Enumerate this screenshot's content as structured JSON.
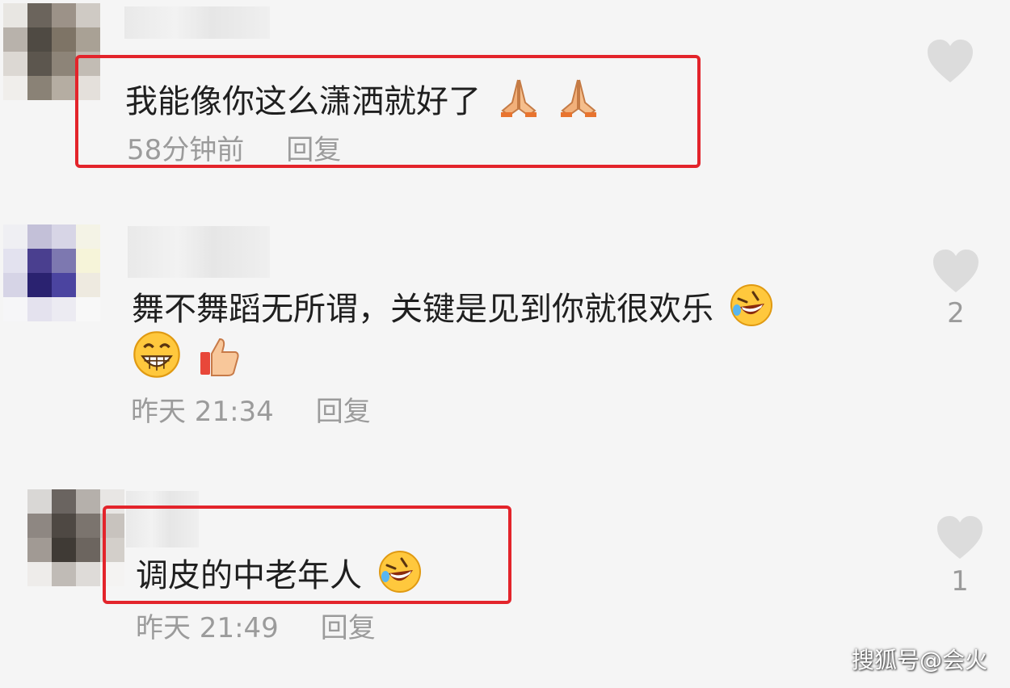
{
  "comments": [
    {
      "text": "我能像你这么潇洒就好了",
      "time": "58分钟前",
      "reply": "回复",
      "likes": "",
      "emojis": [
        "pray-emoji",
        "pray-emoji"
      ],
      "highlighted": true
    },
    {
      "text": "舞不舞蹈无所谓，关键是见到你就很欢乐",
      "time": "昨天 21:34",
      "reply": "回复",
      "likes": "2",
      "emojis": [
        "rofl-emoji",
        "grin-emoji",
        "thumbs-up-emoji"
      ],
      "highlighted": false
    },
    {
      "text": "调皮的中老年人",
      "time": "昨天 21:49",
      "reply": "回复",
      "likes": "1",
      "emojis": [
        "rofl-emoji"
      ],
      "highlighted": true
    }
  ],
  "watermark": "搜狐号@会火",
  "colors": {
    "highlight_border": "#e3242b",
    "meta_text": "#9b9b9b",
    "heart": "#dcdcdc",
    "background": "#f5f5f5"
  }
}
